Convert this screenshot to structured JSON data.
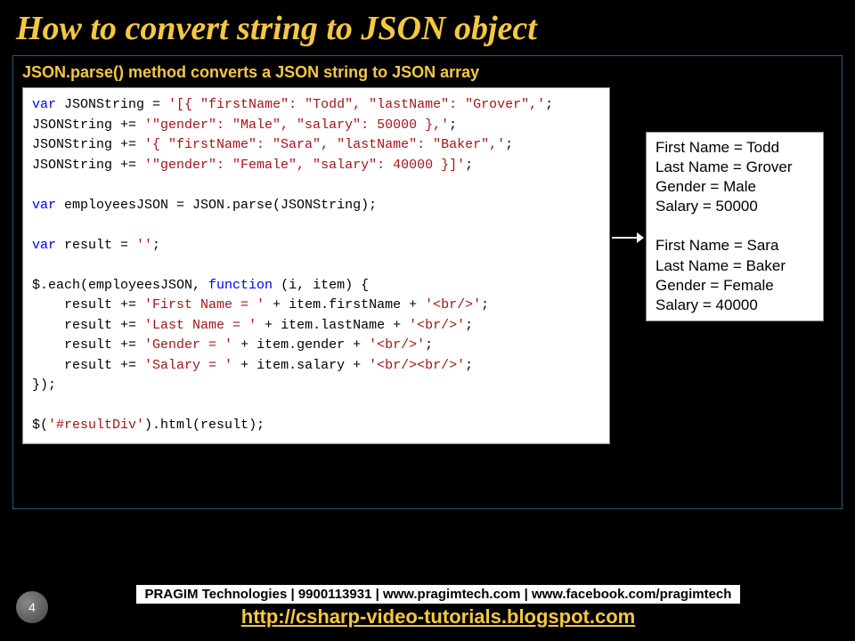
{
  "title": "How to convert string to JSON object",
  "subtitle": "JSON.parse() method converts a JSON string to JSON array",
  "code": {
    "l1a": "var",
    "l1b": " JSONString = ",
    "l1c": "'[{ \"firstName\": \"Todd\", \"lastName\": \"Grover\",'",
    "l1d": ";",
    "l2a": "JSONString += ",
    "l2b": "'\"gender\": \"Male\", \"salary\": 50000 },'",
    "l2c": ";",
    "l3a": "JSONString += ",
    "l3b": "'{ \"firstName\": \"Sara\", \"lastName\": \"Baker\",'",
    "l3c": ";",
    "l4a": "JSONString += ",
    "l4b": "'\"gender\": \"Female\", \"salary\": 40000 }]'",
    "l4c": ";",
    "l5a": "var",
    "l5b": " employeesJSON = JSON.parse(JSONString);",
    "l6a": "var",
    "l6b": " result = ",
    "l6c": "''",
    "l6d": ";",
    "l7a": "$.each(employeesJSON, ",
    "l7b": "function",
    "l7c": " (i, item) {",
    "l8a": "    result += ",
    "l8b": "'First Name = '",
    "l8c": " + item.firstName + ",
    "l8d": "'<br/>'",
    "l8e": ";",
    "l9a": "    result += ",
    "l9b": "'Last Name = '",
    "l9c": " + item.lastName + ",
    "l9d": "'<br/>'",
    "l9e": ";",
    "l10a": "    result += ",
    "l10b": "'Gender = '",
    "l10c": " + item.gender + ",
    "l10d": "'<br/>'",
    "l10e": ";",
    "l11a": "    result += ",
    "l11b": "'Salary = '",
    "l11c": " + item.salary + ",
    "l11d": "'<br/><br/>'",
    "l11e": ";",
    "l12": "});",
    "l13a": "$(",
    "l13b": "'#resultDiv'",
    "l13c": ").html(result);"
  },
  "output": "First Name = Todd\nLast Name = Grover\nGender = Male\nSalary = 50000\n\nFirst Name = Sara\nLast Name = Baker\nGender = Female\nSalary = 40000",
  "footer": {
    "info": "PRAGIM Technologies | 9900113931 | www.pragimtech.com | www.facebook.com/pragimtech",
    "link": "http://csharp-video-tutorials.blogspot.com",
    "page": "4"
  }
}
